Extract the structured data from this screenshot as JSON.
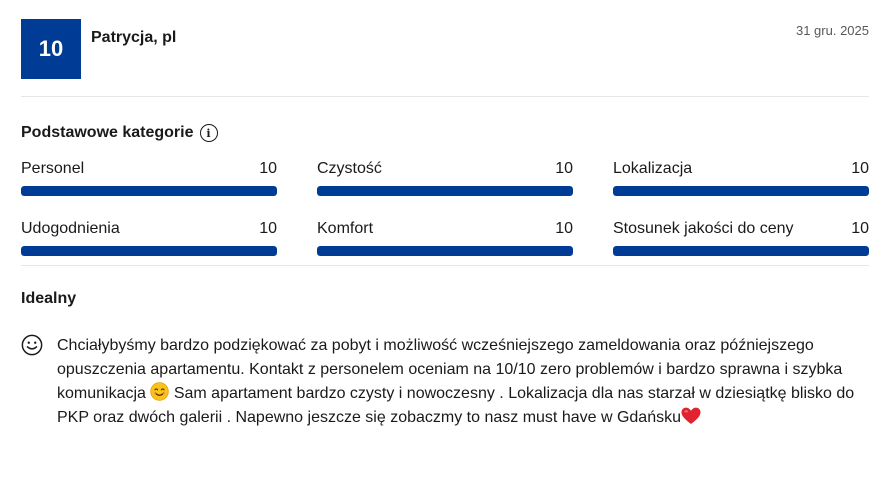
{
  "review": {
    "score": "10",
    "author": "Patrycja, pl",
    "date": "31 gru. 2025",
    "categories_heading": "Podstawowe kategorie",
    "title": "Idealny",
    "text_part1": "Chciałybyśmy bardzo podziękować za pobyt i możliwość wcześniejszego zameldowania oraz późniejszego opuszczenia apartamentu. Kontakt z personelem oceniam na 10/10 zero problemów i bardzo sprawna i szybka komunikacja ",
    "text_part2": " Sam apartament bardzo czysty i nowoczesny . Lokalizacja dla nas starzał w dziesiątkę blisko do PKP oraz dwóch galerii . Napewno jeszcze się zobaczmy to nasz must have w Gdańsku",
    "categories": [
      {
        "label": "Personel",
        "score": "10",
        "fraction": 1.0
      },
      {
        "label": "Czystość",
        "score": "10",
        "fraction": 1.0
      },
      {
        "label": "Lokalizacja",
        "score": "10",
        "fraction": 1.0
      },
      {
        "label": "Udogodnienia",
        "score": "10",
        "fraction": 1.0
      },
      {
        "label": "Komfort",
        "score": "10",
        "fraction": 1.0
      },
      {
        "label": "Stosunek jakości do ceny",
        "score": "10",
        "fraction": 1.0
      }
    ]
  },
  "icons": {
    "info": "info-icon",
    "positive": "smiley-face-icon",
    "emoji_smile": "smiling-emoji-icon",
    "emoji_heart": "red-heart-emoji-icon"
  },
  "colors": {
    "accent": "#003b95",
    "bar_track": "#e7e7e7",
    "heart": "#e0232e"
  }
}
